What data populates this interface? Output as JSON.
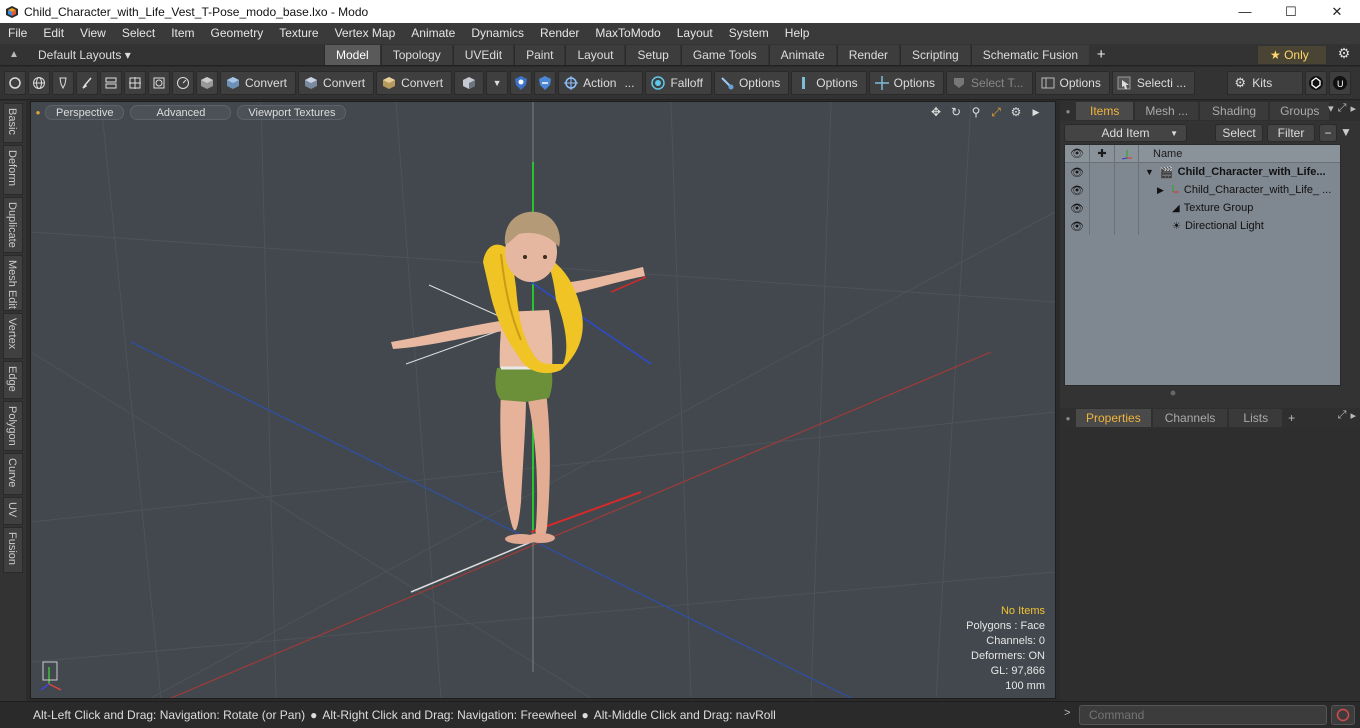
{
  "window": {
    "title": "Child_Character_with_Life_Vest_T-Pose_modo_base.lxo - Modo",
    "minimize": "—",
    "maximize": "☐",
    "close": "✕"
  },
  "menu": [
    "File",
    "Edit",
    "View",
    "Select",
    "Item",
    "Geometry",
    "Texture",
    "Vertex Map",
    "Animate",
    "Dynamics",
    "Render",
    "MaxToModo",
    "Layout",
    "System",
    "Help"
  ],
  "layout_bar": {
    "layouts_label": "Default Layouts ▾",
    "tabs": [
      "Model",
      "Topology",
      "UVEdit",
      "Paint",
      "Layout",
      "Setup",
      "Game Tools",
      "Animate",
      "Render",
      "Scripting",
      "Schematic Fusion"
    ],
    "active_tab": "Model",
    "plus": "+",
    "only_label": "★  Only"
  },
  "toolbar": {
    "convert1": "Convert",
    "convert2": "Convert",
    "convert3": "Convert",
    "action": "Action",
    "action_more": "...",
    "falloff": "Falloff",
    "options1": "Options",
    "options2": "Options",
    "options3": "Options",
    "select_t": "Select T...",
    "options4": "Options",
    "selecti": "Selecti ...",
    "kits": "Kits"
  },
  "left_tabs": [
    "Basic",
    "Deform",
    "Duplicate",
    "Mesh Edit",
    "Vertex",
    "Edge",
    "Polygon",
    "Curve",
    "UV",
    "Fusion"
  ],
  "viewport": {
    "perspective": "Perspective",
    "advanced": "Advanced",
    "textures": "Viewport Textures",
    "info": {
      "no_items": "No Items",
      "polygons": "Polygons : Face",
      "channels": "Channels: 0",
      "deformers": "Deformers: ON",
      "gl": "GL: 97,866",
      "scale": "100 mm"
    }
  },
  "items_panel": {
    "tabs": [
      "Items",
      "Mesh ...",
      "Shading",
      "Groups"
    ],
    "active_tab": "Items",
    "add_item": "Add Item",
    "select": "Select",
    "filter": "Filter",
    "name_header": "Name",
    "rows": [
      {
        "label": "Child_Character_with_Life...",
        "bold": true
      },
      {
        "label": "Child_Character_with_Life_ ...",
        "bold": false
      },
      {
        "label": "Texture Group",
        "bold": false
      },
      {
        "label": "Directional Light",
        "bold": false
      }
    ]
  },
  "props_panel": {
    "tabs": [
      "Properties",
      "Channels",
      "Lists"
    ],
    "active_tab": "Properties",
    "plus": "+"
  },
  "status": {
    "hint1": "Alt-Left Click and Drag: Navigation: Rotate (or Pan)",
    "hint2": "Alt-Right Click and Drag: Navigation: Freewheel",
    "hint3": "Alt-Middle Click and Drag: navRoll",
    "command_placeholder": "Command"
  }
}
